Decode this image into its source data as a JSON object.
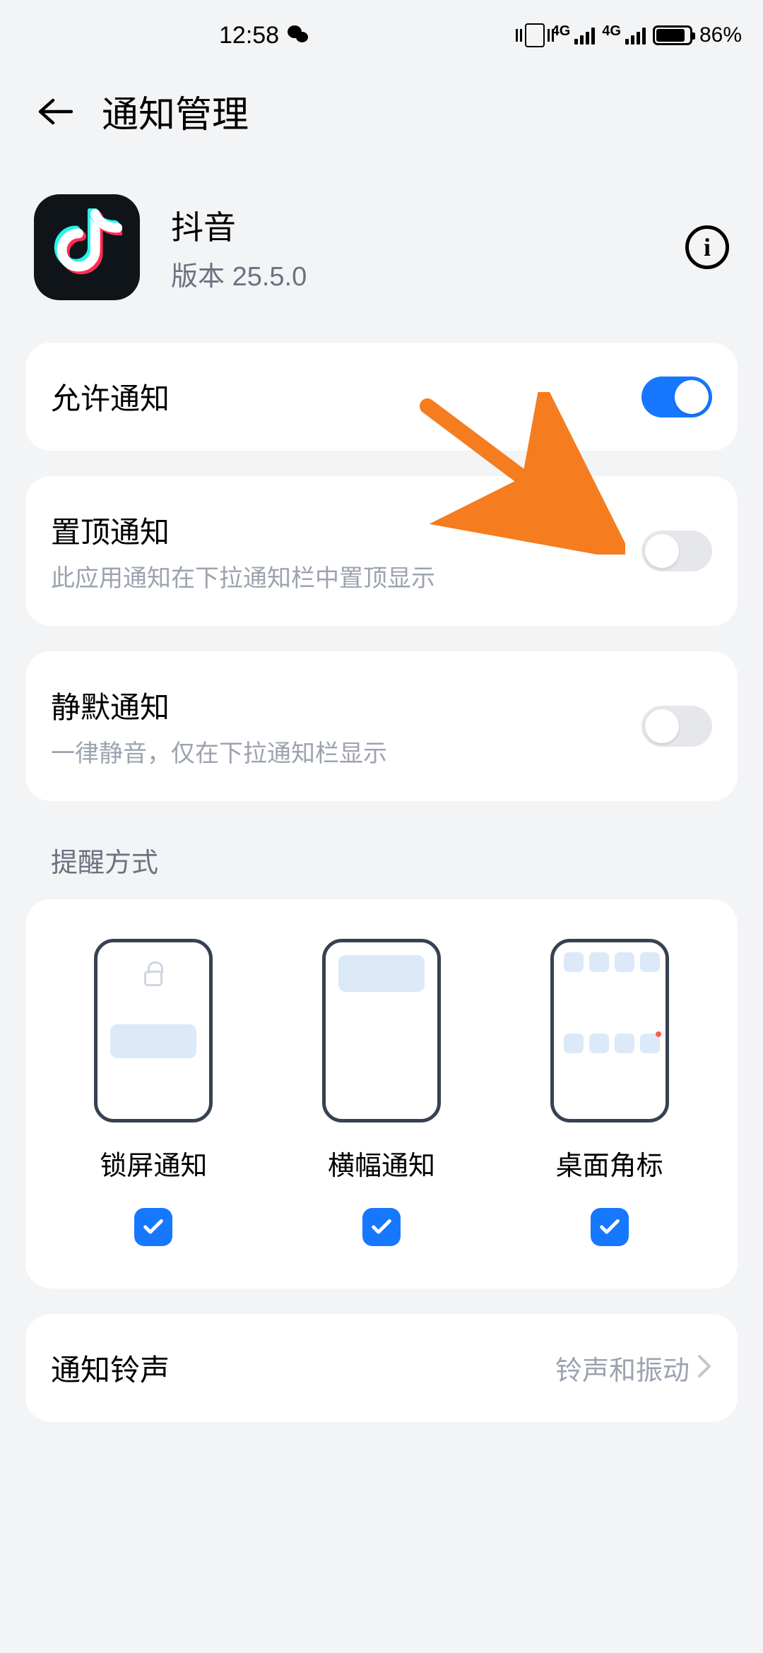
{
  "status": {
    "time": "12:58",
    "battery_pct": "86%",
    "sig_label": "4G"
  },
  "header": {
    "title": "通知管理"
  },
  "app": {
    "name": "抖音",
    "version_prefix": "版本 ",
    "version": "25.5.0"
  },
  "rows": {
    "allow": {
      "title": "允许通知"
    },
    "pin": {
      "title": "置顶通知",
      "sub": "此应用通知在下拉通知栏中置顶显示"
    },
    "silent": {
      "title": "静默通知",
      "sub": "一律静音，仅在下拉通知栏显示"
    },
    "ringtone": {
      "title": "通知铃声",
      "value": "铃声和振动"
    }
  },
  "section": {
    "reminder": "提醒方式"
  },
  "modes": {
    "lockscreen": "锁屏通知",
    "banner": "横幅通知",
    "badge": "桌面角标"
  }
}
